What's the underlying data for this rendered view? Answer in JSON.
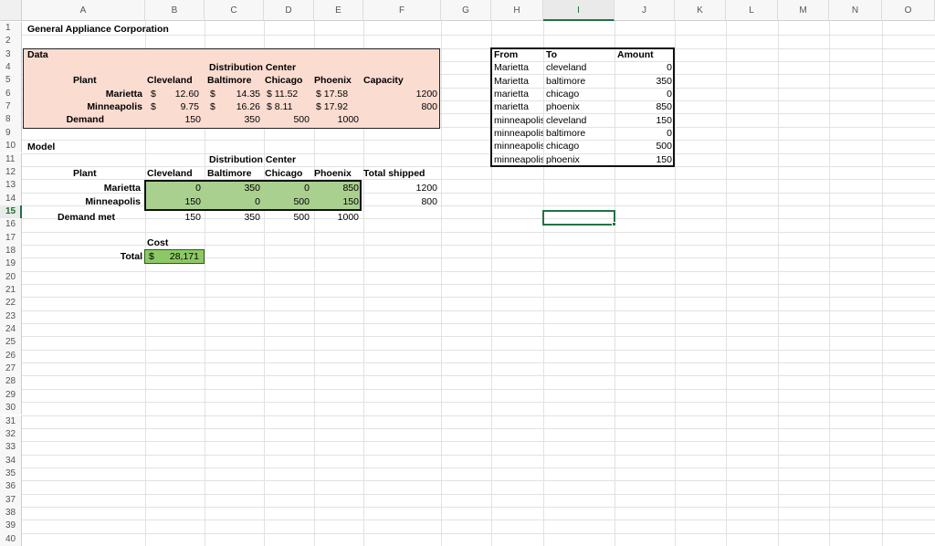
{
  "columns": [
    "A",
    "B",
    "C",
    "D",
    "E",
    "F",
    "G",
    "H",
    "I",
    "J",
    "K",
    "L",
    "M",
    "N",
    "O"
  ],
  "rows": [
    "1",
    "2",
    "3",
    "4",
    "5",
    "6",
    "7",
    "8",
    "9",
    "10",
    "11",
    "12",
    "13",
    "14",
    "15",
    "16",
    "17",
    "18",
    "19",
    "20",
    "21",
    "22",
    "23",
    "24",
    "25",
    "26",
    "27",
    "28",
    "29",
    "30",
    "31",
    "32",
    "33",
    "34",
    "35",
    "36",
    "37",
    "38",
    "39",
    "40"
  ],
  "colors": {
    "data_fill": "#fbdcd1",
    "model_fill": "#a9d08e",
    "select_green": "#217346"
  },
  "cells": {
    "a1": "General Appliance Corporation",
    "a3": "Data",
    "c4": "Distribution Center",
    "a5": "Plant",
    "b5": "Cleveland",
    "c5": "Baltimore",
    "d5": "Chicago",
    "e5": "Phoenix",
    "f5": "Capacity",
    "a6": "Marietta",
    "b6_sym": "$",
    "b6": "12.60",
    "c6_sym": "$",
    "c6": "14.35",
    "d6": "$  11.52",
    "e6": "$  17.58",
    "f6": "1200",
    "a7": "Minneapolis",
    "b7_sym": "$",
    "b7": "9.75",
    "c7_sym": "$",
    "c7": "16.26",
    "d7": "$    8.11",
    "e7": "$  17.92",
    "f7": "800",
    "a8": "Demand",
    "b8": "150",
    "c8": "350",
    "d8": "500",
    "e8": "1000",
    "a10": "Model",
    "c11": "Distribution Center",
    "a12": "Plant",
    "b12": "Cleveland",
    "c12": "Baltimore",
    "d12": "Chicago",
    "e12": "Phoenix",
    "f12": "Total shipped",
    "a13": "Marietta",
    "b13": "0",
    "c13": "350",
    "d13": "0",
    "e13": "850",
    "f13": "1200",
    "a14": "Minneapolis",
    "b14": "150",
    "c14": "0",
    "d14": "500",
    "e14": "150",
    "f14": "800",
    "a15": "Demand met",
    "b15": "150",
    "c15": "350",
    "d15": "500",
    "e15": "1000",
    "b17": "Cost",
    "a18": "Total",
    "b18_sym": "$",
    "b18": "28,171",
    "h3": "From",
    "i3": "To",
    "j3": "Amount",
    "h4": "Marietta",
    "i4": "cleveland",
    "j4": "0",
    "h5": "Marietta",
    "i5": "baltimore",
    "j5": "350",
    "h6": "marietta",
    "i6": "chicago",
    "j6": "0",
    "h7": "marietta",
    "i7": "phoenix",
    "j7": "850",
    "h8": "minneapolis",
    "i8": "cleveland",
    "j8": "150",
    "h9": "minneapolis",
    "i9": "baltimore",
    "j9": "0",
    "h10": "minneapolis",
    "i10": "chicago",
    "j10": "500",
    "h11": "minneapolis",
    "i11": "phoenix",
    "j11": "150"
  }
}
